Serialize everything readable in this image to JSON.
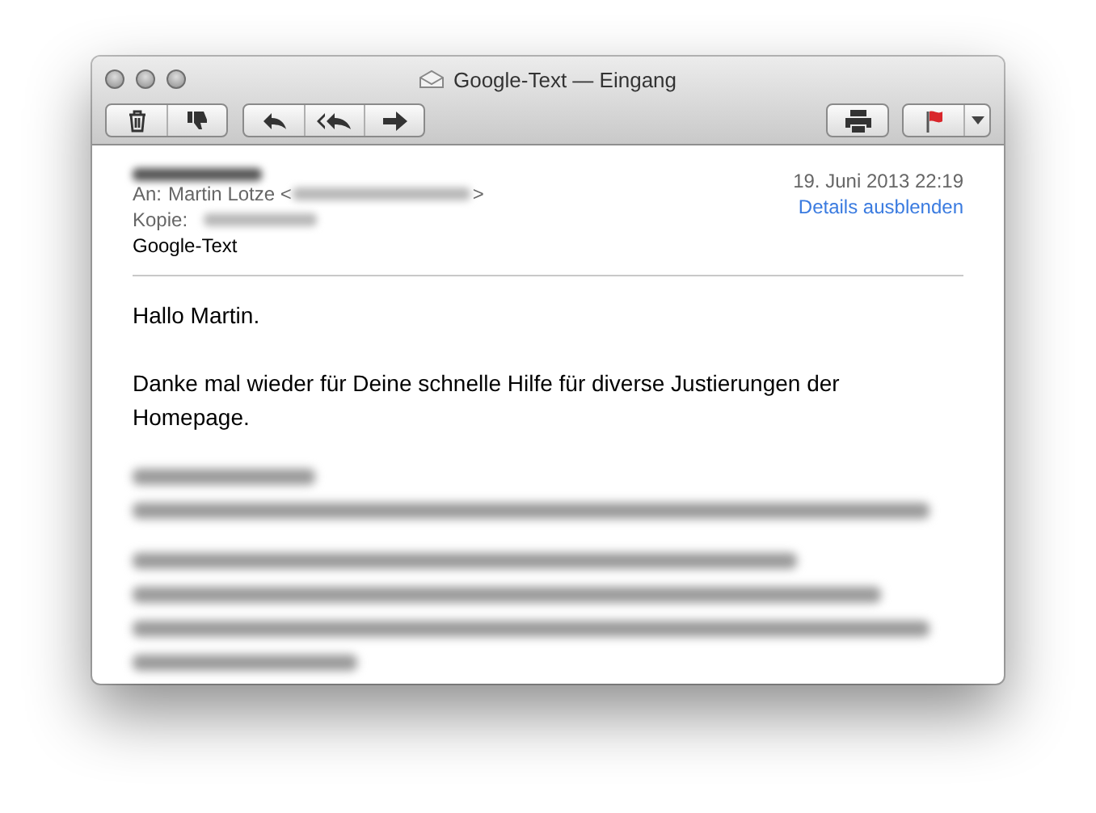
{
  "window": {
    "title": "Google-Text — Eingang"
  },
  "header": {
    "to_label": "An:",
    "to_name": "Martin Lotze <",
    "to_close": ">",
    "cc_label": "Kopie:",
    "subject": "Google-Text",
    "date": "19. Juni 2013 22:19",
    "details_link": "Details ausblenden"
  },
  "body": {
    "paragraphs": [
      "Hallo Martin.",
      "Danke mal wieder für Deine schnelle Hilfe für diverse Justierungen der Homepage."
    ]
  }
}
